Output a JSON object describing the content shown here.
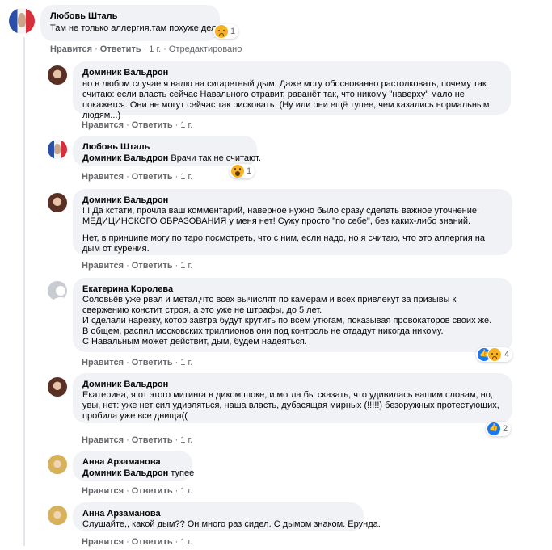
{
  "comments": [
    {
      "author": "Любовь Шталь",
      "text": "Там не только аллергия.там похуже дела.",
      "reaction": {
        "type": "sad-icon",
        "count": "1"
      },
      "actions": {
        "like": "Нравится",
        "reply": "Ответить",
        "time": "1 г.",
        "edited": "Отредактировано"
      }
    },
    {
      "author": "Доминик Вальдрон",
      "text": "но в любом случае я валю на сигаретный дым. Даже могу обоснованно растолковать, почему так считаю: если власть сейчас Навального отравит, раванёт так, что никому \"наверху\" мало не покажется. Они не могут сейчас так рисковать. (Ну или они ещё тупее, чем казались нормальным людям...)",
      "actions": {
        "like": "Нравится",
        "reply": "Ответить",
        "time": "1 г."
      }
    },
    {
      "author": "Любовь Шталь",
      "tag": "Доминик Вальдрон",
      "text": " Врачи так не считают.",
      "reaction": {
        "type": "wow-icon",
        "count": "1"
      },
      "actions": {
        "like": "Нравится",
        "reply": "Ответить",
        "time": "1 г."
      }
    },
    {
      "author": "Доминик Вальдрон",
      "text": "!!! Да кстати, прочла ваш комментарий, наверное нужно было сразу сделать важное уточнение: МЕДИЦИНСКОГО ОБРАЗОВАНИЯ у меня нет! Сужу просто \"по себе\", без каких-либо знаний.",
      "text2": "Нет, в принципе могу по таро посмотреть, что с ним, если надо, но я считаю, что это аллергия на дым от курения.",
      "actions": {
        "like": "Нравится",
        "reply": "Ответить",
        "time": "1 г."
      }
    },
    {
      "author": "Екатерина Королева",
      "text": "Соловьёв уже рвал и метал,что всех вычислят по камерам и всех привлекут за призывы к свержению констит строя, а это уже не штрафы, до 5 лет.",
      "text2": "И сделали нарезку, котор завтра будут крутить по всем утюгам, показывая провокаторов своих же.",
      "text3": "В общем, распил московских триллионов они под контроль не отдадут никогда никому.",
      "text4": "С Навальным может действит, дым, будем надеяться.",
      "reaction": {
        "type": "like-sad-icon",
        "count": "4"
      },
      "actions": {
        "like": "Нравится",
        "reply": "Ответить",
        "time": "1 г."
      }
    },
    {
      "author": "Доминик Вальдрон",
      "text": "Екатерина, я от этого митинга в диком шоке, и могла бы сказать, что удивилась вашим словам, но, увы, нет: уже нет сил удивляться, наша власть, дубасящая мирных (!!!!!) безоружных протестующих, пробила уже все днища((",
      "reaction": {
        "type": "like-icon",
        "count": "2"
      },
      "actions": {
        "like": "Нравится",
        "reply": "Ответить",
        "time": "1 г."
      }
    },
    {
      "author": "Анна Арзаманова",
      "tag": "Доминик Вальдрон",
      "text": " тупее",
      "actions": {
        "like": "Нравится",
        "reply": "Ответить",
        "time": "1 г."
      }
    },
    {
      "author": "Анна Арзаманова",
      "text": "Слушайте,, какой дым?? Он много раз сидел. С дымом знаком. Ерунда.",
      "actions": {
        "like": "Нравится",
        "reply": "Ответить",
        "time": "1 г."
      }
    }
  ]
}
